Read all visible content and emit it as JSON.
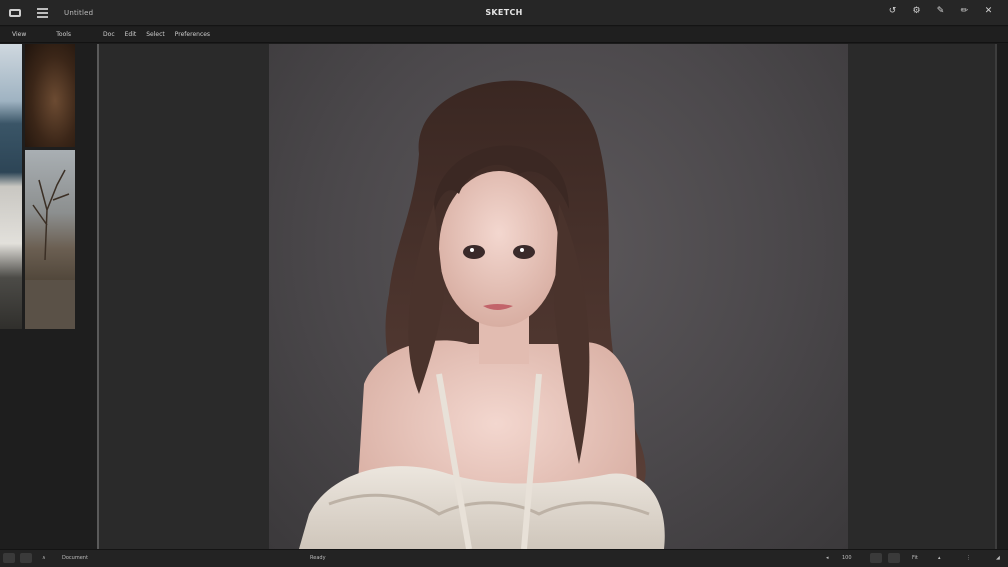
{
  "titlebar": {
    "doc_name": "Untitled",
    "app_title": "SKETCH",
    "icons": [
      "app-logo-icon",
      "menu-icon",
      "undo-icon",
      "settings-icon",
      "pin-icon",
      "pen-icon",
      "close-icon"
    ]
  },
  "menubar": {
    "items": [
      "View",
      "Tools",
      "Doc",
      "Edit",
      "Select",
      "Preferences"
    ]
  },
  "image": {
    "subject": "portrait"
  },
  "statusbar": {
    "left_label": "Document",
    "center_label": "Ready",
    "zoom": "100",
    "right_label": "Fit"
  }
}
